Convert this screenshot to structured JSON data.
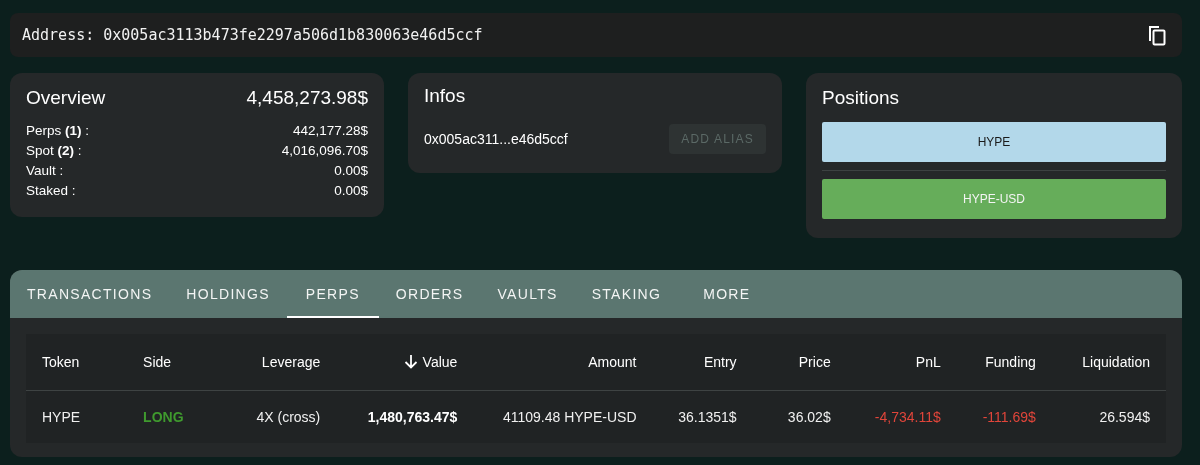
{
  "address_bar": {
    "label": "Address:",
    "value": "0x005ac3113b473fe2297a506d1b830063e46d5ccf"
  },
  "overview": {
    "title": "Overview",
    "total": "4,458,273.98$",
    "rows": [
      {
        "label": "Perps **(1)** :",
        "value": "442,177.28$"
      },
      {
        "label": "Spot **(2)** :",
        "value": "4,016,096.70$"
      },
      {
        "label": "Vault :",
        "value": "0.00$"
      },
      {
        "label": "Staked :",
        "value": "0.00$"
      }
    ]
  },
  "infos": {
    "title": "Infos",
    "address": "0x005ac311...e46d5ccf",
    "button": {
      "label": "ADD ALIAS",
      "disabled": true
    }
  },
  "positions": {
    "title": "Positions",
    "items": [
      {
        "label": "HYPE",
        "color": "#b3d8ea"
      },
      {
        "label": "HYPE-USD",
        "color": "#66ad5a"
      }
    ]
  },
  "tabs": [
    {
      "label": "TRANSACTIONS",
      "selected": false
    },
    {
      "label": "HOLDINGS",
      "selected": false
    },
    {
      "label": "PERPS",
      "selected": true
    },
    {
      "label": "ORDERS",
      "selected": false
    },
    {
      "label": "VAULTS",
      "selected": false
    },
    {
      "label": "STAKING",
      "selected": false
    },
    {
      "label": "MORE",
      "selected": false
    }
  ],
  "table": {
    "columns": [
      {
        "label": "Token",
        "sorted": false
      },
      {
        "label": "Side",
        "sorted": false
      },
      {
        "label": "Leverage",
        "sorted": false
      },
      {
        "label": "Value",
        "sorted": true
      },
      {
        "label": "Amount",
        "sorted": false
      },
      {
        "label": "Entry",
        "sorted": false
      },
      {
        "label": "Price",
        "sorted": false
      },
      {
        "label": "PnL",
        "sorted": false
      },
      {
        "label": "Funding",
        "sorted": false
      },
      {
        "label": "Liquidation",
        "sorted": false
      }
    ],
    "rows": [
      [
        {
          "text": "HYPE",
          "kind": "plain"
        },
        {
          "text": "LONG",
          "kind": "gain"
        },
        {
          "text": "4X (cross)",
          "kind": "plain"
        },
        {
          "text": "1,480,763.47$",
          "kind": "bold"
        },
        {
          "text": "41109.48 HYPE-USD",
          "kind": "plain"
        },
        {
          "text": "36.1351$",
          "kind": "plain"
        },
        {
          "text": "36.02$",
          "kind": "plain"
        },
        {
          "text": "-4,734.11$",
          "kind": "loss"
        },
        {
          "text": "-111.69$",
          "kind": "loss"
        },
        {
          "text": "26.594$",
          "kind": "plain"
        }
      ]
    ]
  }
}
